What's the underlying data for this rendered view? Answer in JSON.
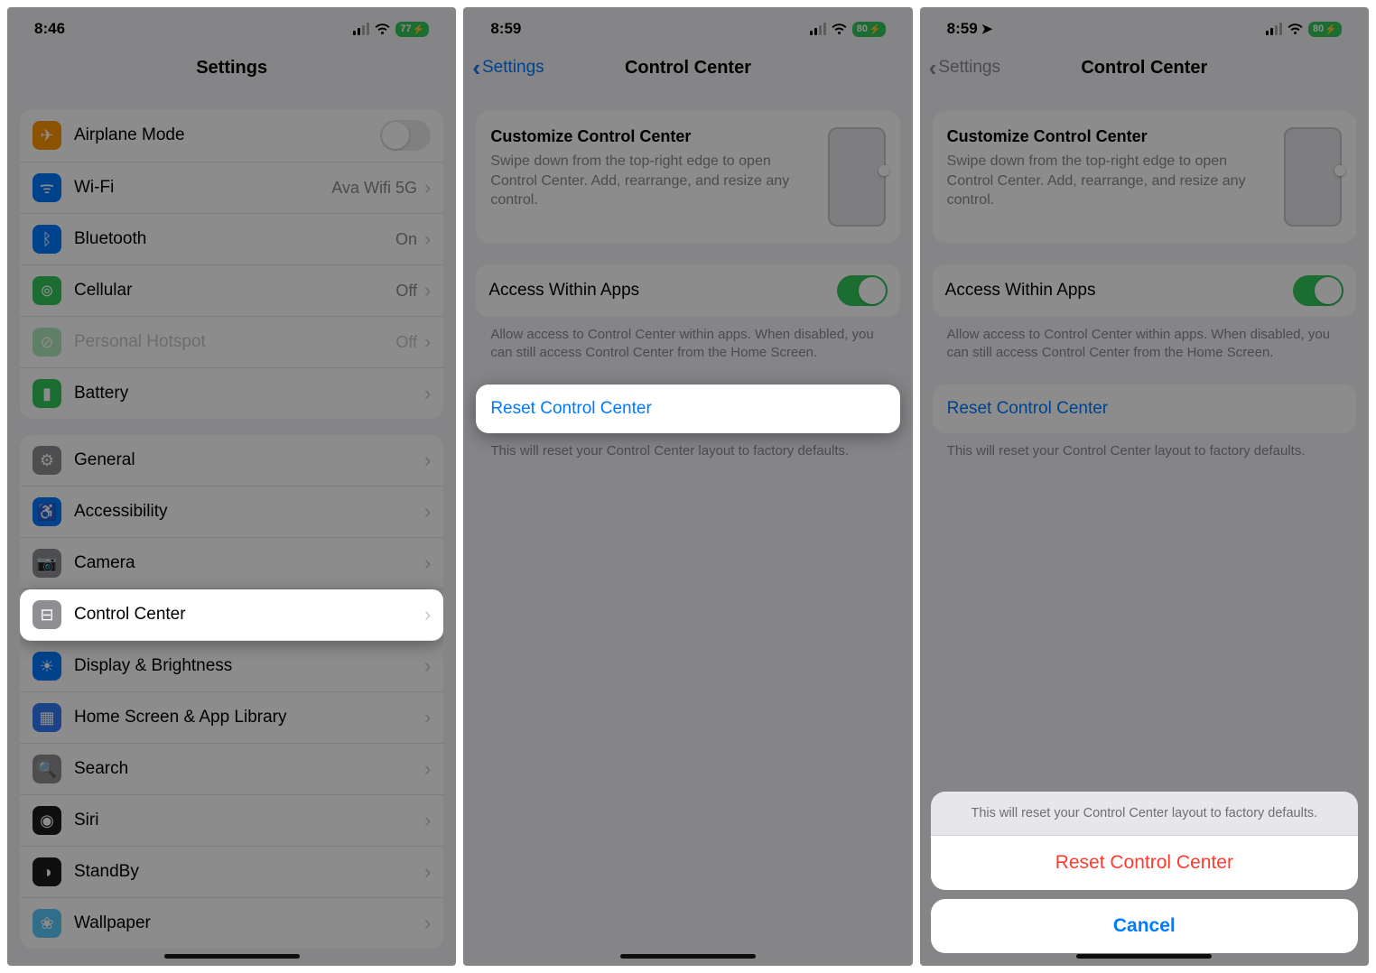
{
  "screen1": {
    "time": "8:46",
    "battery": "77",
    "nav_title": "Settings",
    "group1": [
      {
        "icon": "airplane-icon",
        "label": "Airplane Mode",
        "value": "",
        "toggle": "off",
        "color": "c-orange"
      },
      {
        "icon": "wifi-icon",
        "label": "Wi-Fi",
        "value": "Ava Wifi 5G",
        "chev": true,
        "color": "c-blue"
      },
      {
        "icon": "bluetooth-icon",
        "label": "Bluetooth",
        "value": "On",
        "chev": true,
        "color": "c-blue"
      },
      {
        "icon": "cellular-icon",
        "label": "Cellular",
        "value": "Off",
        "chev": true,
        "color": "c-green"
      },
      {
        "icon": "hotspot-icon",
        "label": "Personal Hotspot",
        "value": "Off",
        "chev": true,
        "color": "c-green",
        "dim": true
      },
      {
        "icon": "battery-icon",
        "label": "Battery",
        "value": "",
        "chev": true,
        "color": "c-green"
      }
    ],
    "group2": [
      {
        "icon": "general-icon",
        "label": "General",
        "chev": true,
        "color": "c-grey"
      },
      {
        "icon": "accessibility-icon",
        "label": "Accessibility",
        "chev": true,
        "color": "c-blue"
      },
      {
        "icon": "camera-icon",
        "label": "Camera",
        "chev": true,
        "color": "c-grey"
      },
      {
        "icon": "control-center-icon",
        "label": "Control Center",
        "chev": true,
        "color": "c-grey",
        "highlight": true
      },
      {
        "icon": "display-icon",
        "label": "Display & Brightness",
        "chev": true,
        "color": "c-blue"
      },
      {
        "icon": "home-screen-icon",
        "label": "Home Screen & App Library",
        "chev": true,
        "color": "c-dblue"
      },
      {
        "icon": "search-icon",
        "label": "Search",
        "chev": true,
        "color": "c-grey"
      },
      {
        "icon": "siri-icon",
        "label": "Siri",
        "chev": true,
        "color": "c-black"
      },
      {
        "icon": "standby-icon",
        "label": "StandBy",
        "chev": true,
        "color": "c-black"
      },
      {
        "icon": "wallpaper-icon",
        "label": "Wallpaper",
        "chev": true,
        "color": "c-lblue"
      }
    ]
  },
  "screen2": {
    "time": "8:59",
    "battery": "80",
    "back_label": "Settings",
    "nav_title": "Control Center",
    "customize_title": "Customize Control Center",
    "customize_body": "Swipe down from the top-right edge to open Control Center. Add, rearrange, and resize any control.",
    "access_label": "Access Within Apps",
    "access_note": "Allow access to Control Center within apps. When disabled, you can still access Control Center from the Home Screen.",
    "reset_label": "Reset Control Center",
    "reset_note": "This will reset your Control Center layout to factory defaults."
  },
  "screen3": {
    "time": "8:59",
    "battery": "80",
    "back_label": "Settings",
    "nav_title": "Control Center",
    "customize_title": "Customize Control Center",
    "customize_body": "Swipe down from the top-right edge to open Control Center. Add, rearrange, and resize any control.",
    "access_label": "Access Within Apps",
    "access_note": "Allow access to Control Center within apps. When disabled, you can still access Control Center from the Home Screen.",
    "reset_label": "Reset Control Center",
    "reset_note": "This will reset your Control Center layout to factory defaults.",
    "sheet_message": "This will reset your Control Center layout to factory defaults.",
    "sheet_destructive": "Reset Control Center",
    "sheet_cancel": "Cancel"
  }
}
